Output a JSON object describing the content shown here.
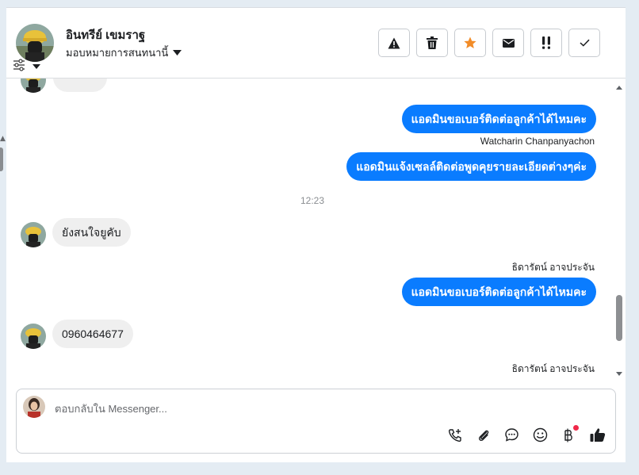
{
  "contact": {
    "name": "อินทรีย์ เขมราฐ",
    "assign_label": "มอบหมายการสนทนานี้"
  },
  "header_actions": [
    {
      "name": "spam-button",
      "icon": "warning-icon"
    },
    {
      "name": "delete-button",
      "icon": "trash-icon"
    },
    {
      "name": "star-button",
      "icon": "star-icon",
      "color": "#f28c28"
    },
    {
      "name": "mark-unread-button",
      "icon": "envelope-icon"
    },
    {
      "name": "follow-up-button",
      "icon": "exclamation-icon"
    },
    {
      "name": "done-button",
      "icon": "check-icon"
    }
  ],
  "messages": {
    "out_1": "แอดมินขอเบอร์ติดต่อลูกค้าได้ไหมคะ",
    "sender_1": "Watcharin Chanpanyachon",
    "out_2": "แอดมินแจ้งเซลล์ติดต่อพูดคุยรายละเอียดต่างๆค่ะ",
    "time": "12:23",
    "in_1": "ยังสนใจยูคับ",
    "sender_2": "ธิดารัตน์ อาจประจัน",
    "out_3": "แอดมินขอเบอร์ติดต่อลูกค้าได้ไหมคะ",
    "in_2": "0960464677",
    "sender_3": "ธิดารัตน์ อาจประจัน"
  },
  "composer": {
    "placeholder": "ตอบกลับใน Messenger...",
    "tools": [
      "call-add-icon",
      "attachment-icon",
      "chat-bubble-icon",
      "emoji-icon",
      "baht-icon",
      "thumbs-up-icon"
    ]
  },
  "colors": {
    "accent": "#0a7cff",
    "incoming_bubble": "#efefef",
    "star": "#f28c28",
    "notification": "#f02849"
  }
}
